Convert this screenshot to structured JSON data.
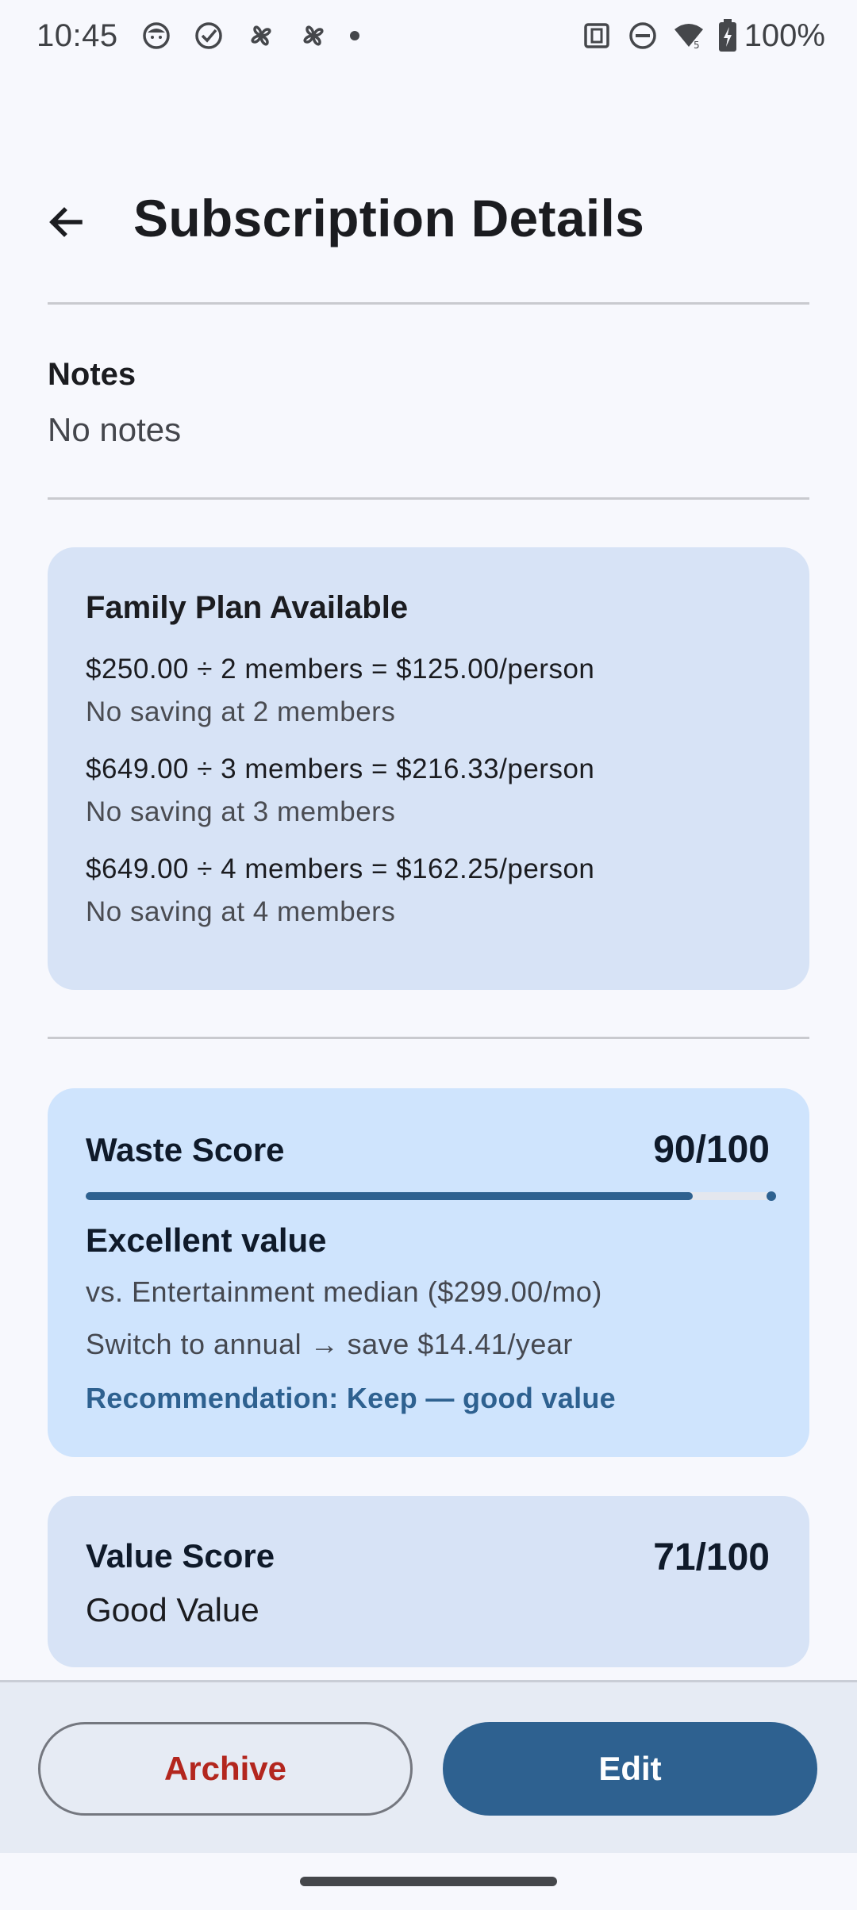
{
  "status_bar": {
    "time": "10:45",
    "left_icons": [
      "face-icon",
      "check-circle-icon",
      "pinwheel-icon",
      "pinwheel-icon",
      "dot-icon"
    ],
    "right_icons": [
      "nfc-icon",
      "dnd-icon",
      "wifi-icon",
      "battery-charging-icon"
    ],
    "wifi_badge": "5",
    "battery": "100%"
  },
  "header": {
    "title": "Subscription Details",
    "back_icon": "arrow-back-icon"
  },
  "notes": {
    "label": "Notes",
    "value": "No notes"
  },
  "family_plan": {
    "title": "Family Plan Available",
    "rows": [
      {
        "calc": "$250.00 ÷ 2 members = $125.00/person",
        "saving": "No saving at 2 members"
      },
      {
        "calc": "$649.00 ÷ 3 members = $216.33/person",
        "saving": "No saving at 3 members"
      },
      {
        "calc": "$649.00 ÷ 4 members = $162.25/person",
        "saving": "No saving at 4 members"
      }
    ]
  },
  "waste_score": {
    "title": "Waste Score",
    "score": "90/100",
    "progress": 0.9,
    "verdict": "Excellent value",
    "median": "vs. Entertainment median ($299.00/mo)",
    "annual": "Switch to annual → save $14.41/year",
    "recommendation": "Recommendation: Keep — good value"
  },
  "value_score": {
    "title": "Value Score",
    "score": "71/100",
    "label": "Good Value"
  },
  "actions": {
    "archive": "Archive",
    "edit": "Edit"
  },
  "colors": {
    "accent": "#2e6190",
    "danger": "#b3261e",
    "background": "#f7f8fd",
    "card": "#d7e3f6",
    "card_highlight": "#cfe4fd"
  }
}
